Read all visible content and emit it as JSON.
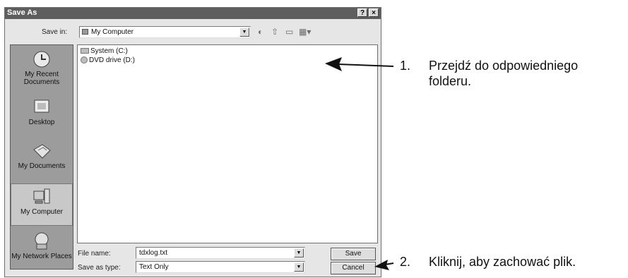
{
  "dialog": {
    "title": "Save As",
    "help_label": "?",
    "close_label": "×",
    "save_in_label": "Save in:",
    "save_in_value": "My Computer",
    "places": [
      {
        "label": "My Recent Documents"
      },
      {
        "label": "Desktop"
      },
      {
        "label": "My Documents"
      },
      {
        "label": "My Computer"
      },
      {
        "label": "My Network Places"
      }
    ],
    "files": [
      {
        "name": "System (C:)"
      },
      {
        "name": "DVD drive (D:)"
      }
    ],
    "file_name_label": "File name:",
    "file_name_value": "tdxlog.txt",
    "save_type_label": "Save as type:",
    "save_type_value": "Text Only",
    "save_button": "Save",
    "cancel_button": "Cancel"
  },
  "annotations": {
    "step1_number": "1.",
    "step1_text_line1": "Przejdź do odpowiedniego",
    "step1_text_line2": "folderu.",
    "step2_number": "2.",
    "step2_text": "Kliknij, aby zachować plik."
  }
}
